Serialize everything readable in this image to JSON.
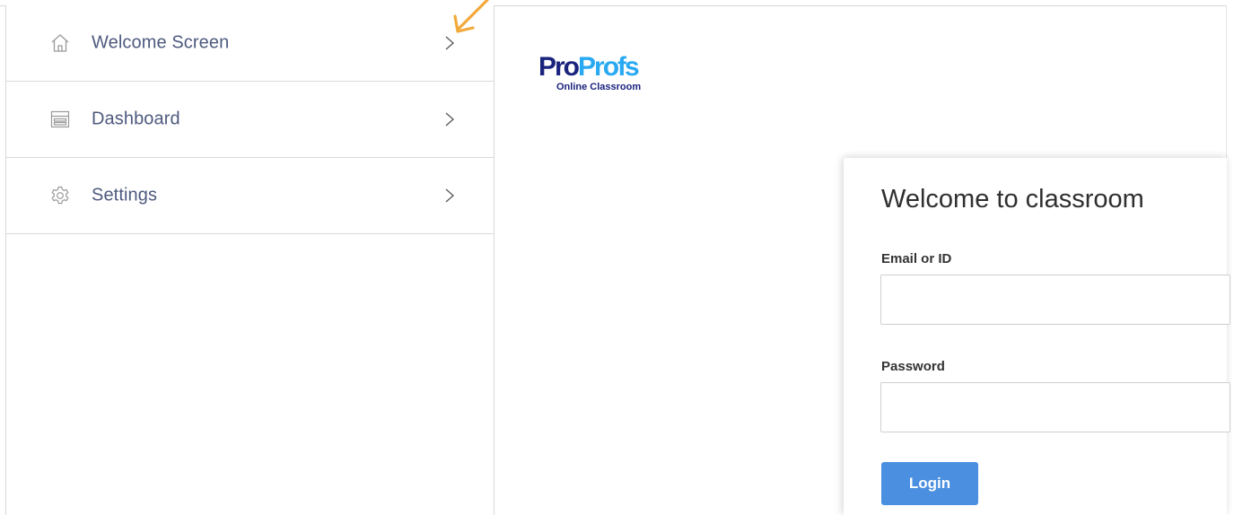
{
  "sidebar": {
    "items": [
      {
        "label": "Welcome Screen",
        "icon": "home-icon"
      },
      {
        "label": "Dashboard",
        "icon": "dashboard-icon"
      },
      {
        "label": "Settings",
        "icon": "gear-icon"
      }
    ]
  },
  "logo": {
    "brand_part1": "Pro",
    "brand_part2": "Profs",
    "subtitle": "Online Classroom"
  },
  "login": {
    "title": "Welcome to classroom",
    "email_label": "Email or ID",
    "email_value": "",
    "password_label": "Password",
    "password_value": "",
    "button_label": "Login"
  },
  "colors": {
    "nav_text": "#4e5a7e",
    "brand_dark": "#1a237e",
    "brand_light": "#29a9f2",
    "button": "#4a8fe0",
    "annotation": "#f2a93b"
  }
}
